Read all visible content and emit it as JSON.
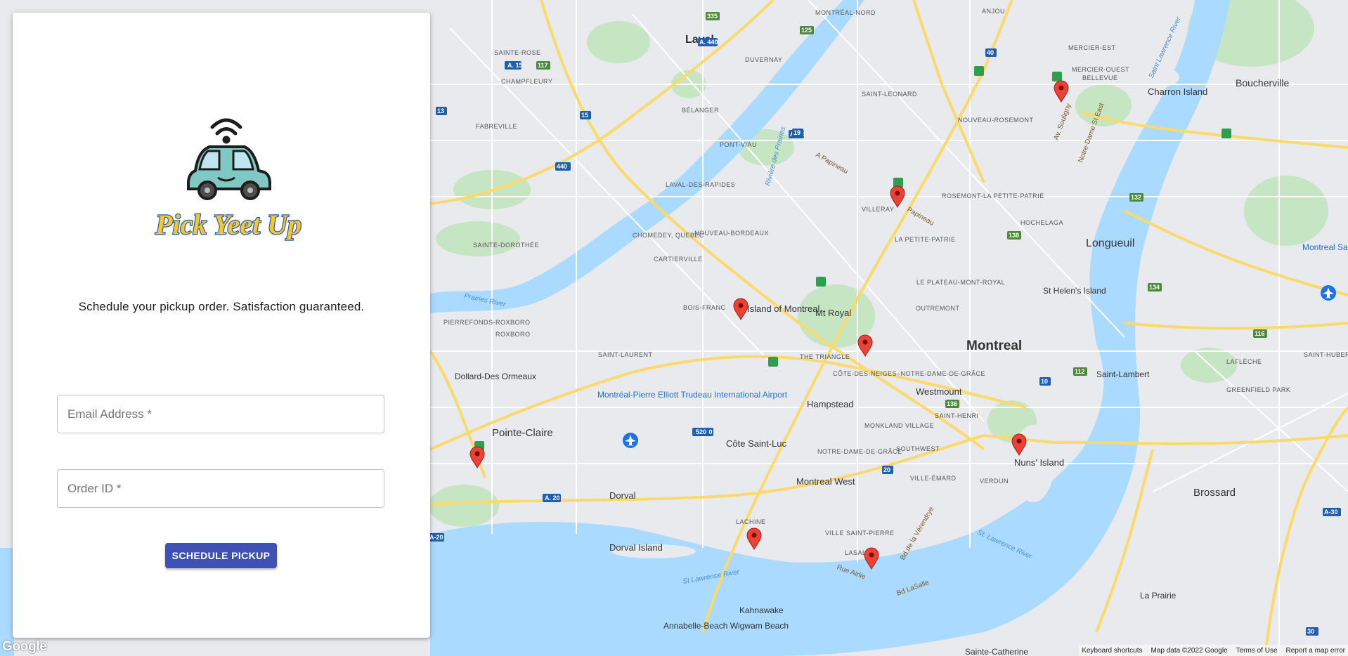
{
  "brand": {
    "name": "Pick Yeet Up",
    "accent": "#3f51b5",
    "logo_text_color": "#f2c830",
    "logo_outline_color": "#2f5cae"
  },
  "form": {
    "tagline": "Schedule your pickup order. Satisfaction guaranteed.",
    "email_placeholder": "Email Address *",
    "order_placeholder": "Order ID *",
    "submit_label": "SCHEDULE PICKUP"
  },
  "map": {
    "google_logo": "Google",
    "attribution": [
      "Keyboard shortcuts",
      "Map data ©2022 Google",
      "Terms of Use",
      "Report a map error"
    ],
    "big_labels": [
      "Laval",
      "Montreal",
      "Longueuil",
      "Pointe-Claire",
      "Brossard",
      "Boucherville",
      "Charron Island",
      "Nuns' Island",
      "Dorval Island"
    ],
    "labels": [
      "Island of Montreal",
      "Mt Royal",
      "Hampstead",
      "Westmount",
      "Côte Saint-Luc",
      "Montreal West",
      "Dorval",
      "Kahnawake",
      "Saint-Lambert",
      "La Prairie",
      "St Helen's Island",
      "Montréal-Pierre Elliott Trudeau International Airport",
      "Dollard-Des Ormeaux",
      "Annabelle-Beach Wigwam Beach",
      "Montreal Saint-Hubert Longueuil Airport",
      "Sainte-Catherine"
    ],
    "small_labels": [
      "SAINTE-ROSE",
      "CHAMPFLEURY",
      "FABREVILLE",
      "DUVERNAY",
      "BÉLANGER",
      "PONT-VIAU",
      "LAVAL-DES-RAPIDES",
      "CHOMEDEY, QUEBEC",
      "NOUVEAU-BORDEAUX",
      "CARTIERVILLE",
      "BOIS-FRANC",
      "SAINTE-DOROTHÉE",
      "PIERREFONDS-ROXBORO",
      "ROXBORO",
      "SAINT-LAURENT",
      "MONTRÉAL-NORD",
      "SAINT-LEONARD",
      "NOUVEAU-ROSEMONT",
      "MERCIER-EST",
      "MERCIER-OUEST",
      "BELLEVUE",
      "ANJOU",
      "ROSEMONT-LA PETITE-PATRIE",
      "VILLERAY",
      "LA PETITE-PATRIE",
      "HOCHELAGA",
      "LE PLATEAU-MONT-ROYAL",
      "OUTREMONT",
      "THE TRIANGLE",
      "CÔTE-DES-NEIGES–NOTRE-DAME-DE-GRÂCE",
      "MONKLAND VILLAGE",
      "SAINT-HENRI",
      "SOUTHWEST",
      "NOTRE-DAME-DE-GRÂCE",
      "VILLE-ÉMARD",
      "VERDUN",
      "VILLE SAINT-PIERRE",
      "LACHINE",
      "LASALLE",
      "LAFLÈCHE",
      "GREENFIELD PARK",
      "SAINT-HUBERT"
    ],
    "water_labels": [
      "Prairies River",
      "Rivière des Prairies",
      "St Lawrence River",
      "St. Lawrence River",
      "Saint Lawrence River"
    ],
    "street_labels": [
      "A Papineau",
      "Papineau",
      "Av. Souligny",
      "Notre-Dame St East",
      "Bd de la Vérendrye",
      "Rue Airlie",
      "Bd LaSalle"
    ],
    "highway_shields": [
      "A. 440",
      "A. 15",
      "A. 20",
      "A. 520",
      "A. 19",
      "A-30",
      "A-20",
      "335",
      "125",
      "40",
      "13",
      "117",
      "15",
      "19",
      "440",
      "138",
      "132",
      "134",
      "116",
      "112",
      "10",
      "136",
      "20",
      "520",
      "30"
    ]
  },
  "colors": {
    "land": "#e8eaed",
    "water": "#aadaff",
    "park": "#c8e6c9",
    "highway": "#fbd96a",
    "pin": "#ea4335"
  }
}
